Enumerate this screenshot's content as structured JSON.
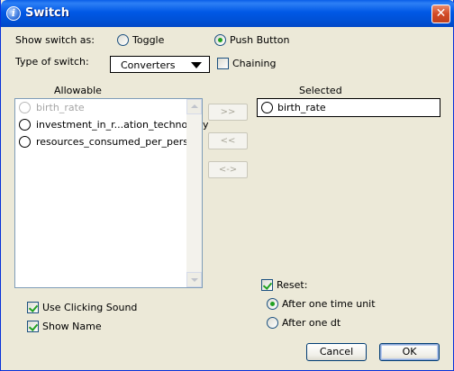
{
  "window": {
    "title": "Switch",
    "title_icon": "info-icon",
    "close_glyph": "✕"
  },
  "show_switch": {
    "label": "Show switch as:",
    "options": [
      {
        "label": "Toggle",
        "checked": false
      },
      {
        "label": "Push Button",
        "checked": true
      }
    ]
  },
  "type_of_switch": {
    "label": "Type of switch:",
    "selected": "Converters",
    "chaining": {
      "label": "Chaining",
      "checked": false
    }
  },
  "allowable": {
    "heading": "Allowable",
    "items": [
      {
        "label": "birth_rate",
        "enabled": false
      },
      {
        "label": "investment_in_r...ation_technology",
        "enabled": true
      },
      {
        "label": "resources_consumed_per_person",
        "enabled": true
      }
    ]
  },
  "selected": {
    "heading": "Selected",
    "items": [
      {
        "label": "birth_rate"
      }
    ]
  },
  "move_buttons": {
    "add": ">>",
    "remove": "<<",
    "swap": "<->"
  },
  "options": {
    "use_clicking_sound": {
      "label": "Use Clicking Sound",
      "checked": true
    },
    "show_name": {
      "label": "Show Name",
      "checked": true
    }
  },
  "reset": {
    "label": "Reset:",
    "checked": true,
    "choices": [
      {
        "label": "After one time unit",
        "checked": true
      },
      {
        "label": "After one dt",
        "checked": false
      }
    ]
  },
  "buttons": {
    "cancel": "Cancel",
    "ok": "OK"
  },
  "colors": {
    "titlebar": "#0058e6",
    "dialog_bg": "#ece9d8",
    "check_green": "#21a121"
  }
}
